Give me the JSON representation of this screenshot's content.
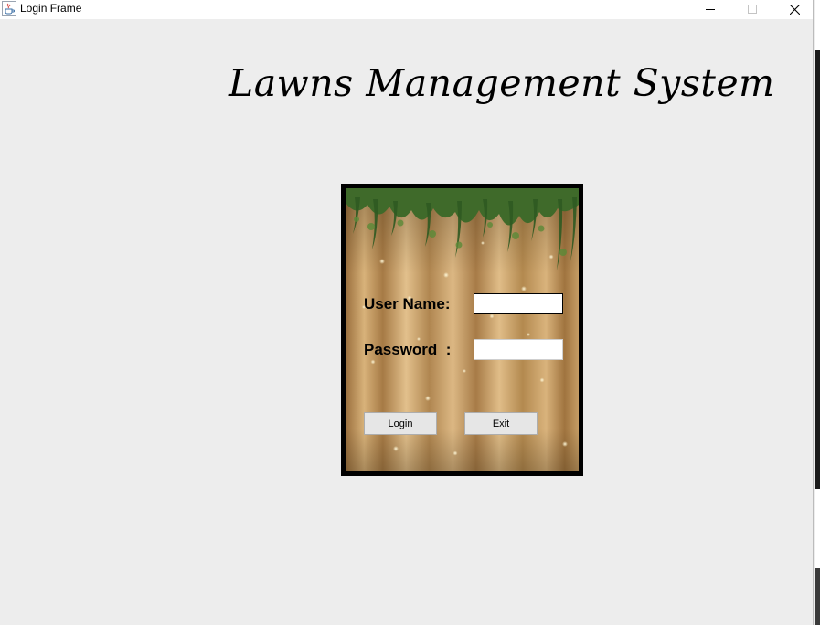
{
  "window": {
    "title": "Login Frame",
    "app_icon": "java-cup-icon",
    "controls": [
      "minimize-icon",
      "maximize-icon",
      "close-icon"
    ]
  },
  "heading": "Lawns Management System",
  "login_form": {
    "background": "golden-curtain-with-hanging-vines",
    "username_label": "User Name:",
    "username_value": "",
    "password_label": "Password  :",
    "password_value": "",
    "login_button": "Login",
    "exit_button": "Exit"
  },
  "colors": {
    "window_bg": "#ededed",
    "panel_border": "#000000",
    "button_bg": "#e6e6e6"
  }
}
